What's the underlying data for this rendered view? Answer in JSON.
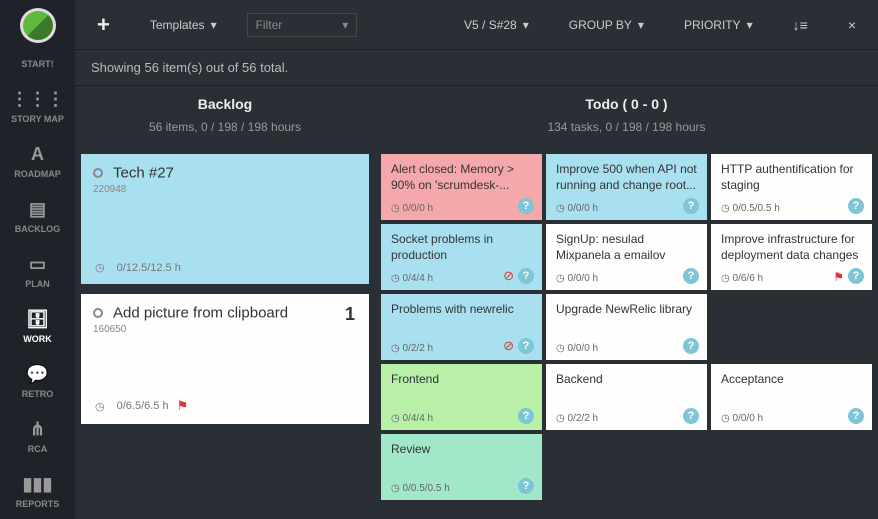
{
  "sidebar": {
    "items": [
      {
        "label": "START!",
        "icon": "●"
      },
      {
        "label": "STORY MAP",
        "icon": "⋮⋮⋮"
      },
      {
        "label": "ROADMAP",
        "icon": "A"
      },
      {
        "label": "BACKLOG",
        "icon": "▤"
      },
      {
        "label": "PLAN",
        "icon": "▭"
      },
      {
        "label": "WORK",
        "icon": "🗄"
      },
      {
        "label": "RETRO",
        "icon": "💬"
      },
      {
        "label": "RCA",
        "icon": "⋔"
      },
      {
        "label": "REPORTS",
        "icon": "▮▮▮"
      }
    ]
  },
  "toolbar": {
    "templates": "Templates",
    "filter_placeholder": "Filter",
    "version": "V5 / S#28",
    "groupby": "GROUP BY",
    "priority": "PRIORITY"
  },
  "status": "Showing 56 item(s) out of 56 total.",
  "columns": {
    "backlog": {
      "title": "Backlog",
      "sub": "56 items, 0 / 198 / 198 hours",
      "cards": [
        {
          "title": "Tech #27",
          "id": "220948",
          "hours": "0/12.5/12.5 h",
          "color": "blue"
        },
        {
          "title": "Add picture from clipboard",
          "id": "160650",
          "hours": "0/6.5/6.5 h",
          "color": "white",
          "flag": true,
          "badge": "1"
        }
      ]
    },
    "todo": {
      "title": "Todo  ( 0 - 0 )",
      "sub": "134 tasks, 0 / 198 / 198 hours",
      "cards": [
        {
          "title": "Alert closed: Memory > 90% on 'scrumdesk-...",
          "hours": "0/0/0 h",
          "color": "pink"
        },
        {
          "title": "Improve 500 when API not running and change root...",
          "hours": "0/0/0 h",
          "color": "blue"
        },
        {
          "title": "HTTP authentification for staging",
          "hours": "0/0.5/0.5 h",
          "color": "white"
        },
        {
          "title": "Socket problems in production",
          "hours": "0/4/4 h",
          "color": "blue",
          "warn": true
        },
        {
          "title": "SignUp: nesulad Mixpanela a emailov",
          "hours": "0/0/0 h",
          "color": "white"
        },
        {
          "title": "Improve infrastructure for deployment data changes",
          "hours": "0/6/6 h",
          "color": "white",
          "flag": true
        },
        {
          "title": "Problems with newrelic",
          "hours": "0/2/2 h",
          "color": "blue",
          "warn": true
        },
        {
          "title": "Upgrade NewRelic library",
          "hours": "0/0/0 h",
          "color": "white"
        },
        {
          "title": "",
          "hours": "",
          "color": "empty"
        },
        {
          "title": "Frontend",
          "hours": "0/4/4 h",
          "color": "green"
        },
        {
          "title": "Backend",
          "hours": "0/2/2 h",
          "color": "white"
        },
        {
          "title": "Acceptance",
          "hours": "0/0/0 h",
          "color": "white"
        },
        {
          "title": "Review",
          "hours": "0/0.5/0.5 h",
          "color": "teal"
        }
      ]
    }
  }
}
